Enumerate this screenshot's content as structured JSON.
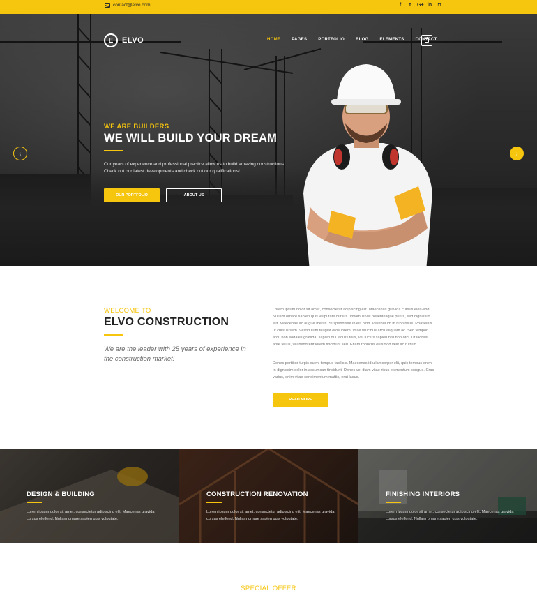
{
  "topbar": {
    "email": "contact@elvo.com",
    "socials": [
      {
        "icon": "facebook-icon",
        "glyph": "f"
      },
      {
        "icon": "twitter-icon",
        "glyph": "t"
      },
      {
        "icon": "google-plus-icon",
        "glyph": "G+"
      },
      {
        "icon": "linkedin-icon",
        "glyph": "in"
      },
      {
        "icon": "instagram-icon",
        "glyph": "◘"
      }
    ],
    "color": "#f6c50e"
  },
  "header": {
    "logo_letter": "E",
    "logo_name": "ELVO",
    "nav": [
      "HOME",
      "PAGES",
      "PORTFOLIO",
      "BLOG",
      "ELEMENTS",
      "CONTACT"
    ],
    "active_nav": "HOME",
    "cart_icon": "shopping-bag-icon"
  },
  "hero": {
    "subtitle": "WE ARE BUILDERS",
    "title": "WE WILL BUILD YOUR DREAM",
    "text": "Our years of experience and professional practice allow us to build amazing constructions. Check out our latest developments and check out our qualifications!",
    "primary_button": "OUR PORTFOLIO",
    "secondary_button": "ABOUT US",
    "prev_arrow": "‹",
    "next_arrow": "›"
  },
  "welcome": {
    "subtitle": "WELCOME TO",
    "title": "ELVO CONSTRUCTION",
    "quote": "We are the leader with 25 years of experience in the construction market!",
    "paragraph1": "Lorem ipsum dolor sit amet, consectetur adipiscing elit. Maecenas gravida cursus eleif-end. Nullam ornare sapien quis vulputate cursus. Vivamus vel pellentesque purus, sed dignissim elit. Maecenas ac augue metus. Suspendisse in elit nibh. Vestibulum in nibh risus. Phasellus ut cursus sem. Vestibulum feugiat eros lorem, vitae faucibus arcu aliquam ac. Sed tempor, arcu non sodales gravida, sapien dui iaculis felis, vel luctus sapien nisl non orci. Ut laoreet ante tellus, vel hendrerit lorem tincidunt sed. Etiam rhoncus euismod velit ac rutrum.",
    "paragraph2": "Donec porttitor turpis eu mi tempus facilisis. Maecenas id ullamcorper elit, quis tempus enim. In dignissim dolor in accumsan tincidunt. Donec vel diam vitae risus elementum congue. Cras varius, enim vitae condimentum mattis, erat lacus.",
    "button": "READ MORE"
  },
  "services": [
    {
      "title": "DESIGN & BUILDING",
      "desc": "Lorem ipsum dolor sit amet, consectetur adipiscing elit. Maecenas gravida cursus eleifend. Nullam ornare sapien quis vulputate."
    },
    {
      "title": "CONSTRUCTION RENOVATION",
      "desc": "Lorem ipsum dolor sit amet, consectetur adipiscing elit. Maecenas gravida cursus eleifend. Nullam ornare sapien quis vulputate."
    },
    {
      "title": "FINISHING INTERIORS",
      "desc": "Lorem ipsum dolor sit amet, consectetur adipiscing elit. Maecenas gravida cursus eleifend. Nullam ornare sapien quis vulputate."
    }
  ],
  "special_offer": {
    "title": "SPECIAL OFFER"
  }
}
